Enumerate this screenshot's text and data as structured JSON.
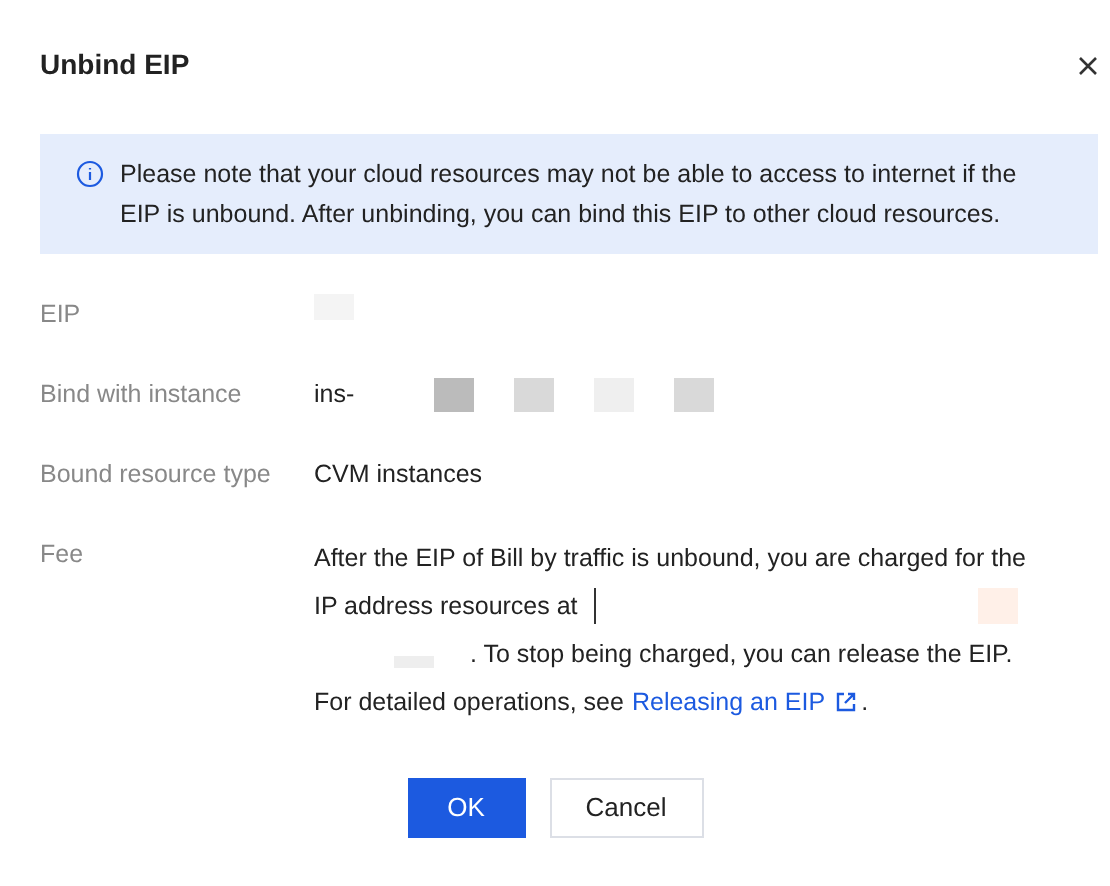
{
  "dialog": {
    "title": "Unbind EIP"
  },
  "notice": {
    "text": "Please note that your cloud resources may not be able to access to internet if the EIP is unbound. After unbinding, you can bind this EIP to other cloud resources."
  },
  "fields": [
    {
      "kind": "redacted",
      "label": "EIP"
    },
    {
      "kind": "instance",
      "label": "Bind with instance",
      "value": "ins-"
    },
    {
      "kind": "text",
      "label": "Bound resource type",
      "value": "CVM instances"
    },
    {
      "kind": "fee",
      "label": "Fee",
      "lines": [
        "After the EIP of Bill by traffic is unbound, you are charged for the",
        "IP address resources at"
      ],
      "text_2": ". To stop being charged, you can release the EIP.",
      "prefix": "For detailed operations, see",
      "link": "Releasing an EIP",
      "suffix": "."
    }
  ],
  "buttons": [
    {
      "label": "OK",
      "kind": "primary"
    },
    {
      "label": "Cancel",
      "kind": "secondary"
    }
  ]
}
